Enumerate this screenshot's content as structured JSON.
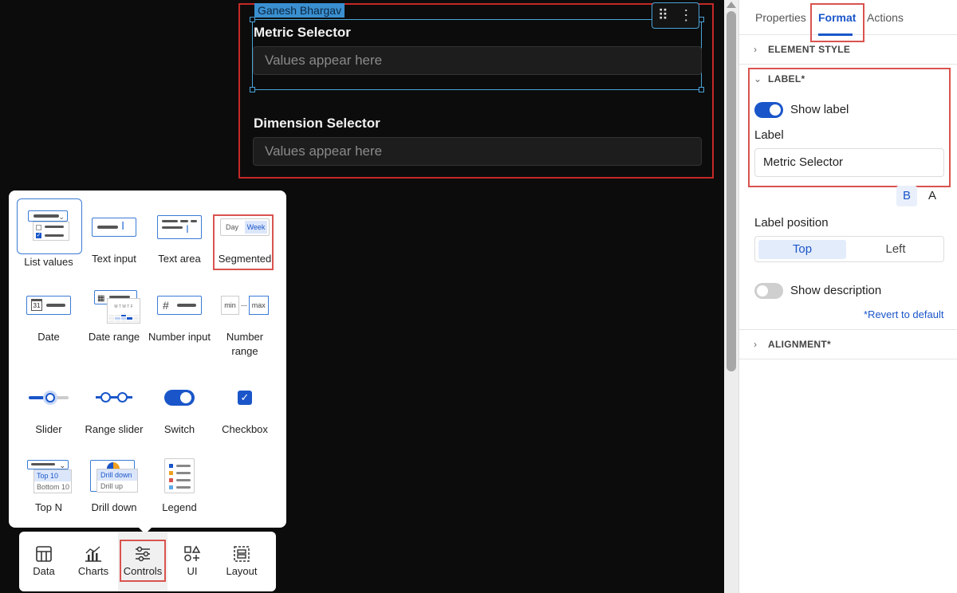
{
  "canvas": {
    "user_tag": "Ganesh Bhargav",
    "fields": [
      {
        "label": "Metric Selector",
        "placeholder": "Values appear here"
      },
      {
        "label": "Dimension Selector",
        "placeholder": "Values appear here"
      }
    ]
  },
  "controls_popup": {
    "items": [
      {
        "label": "List values",
        "icon": "list-values-icon"
      },
      {
        "label": "Text input",
        "icon": "text-input-icon"
      },
      {
        "label": "Text area",
        "icon": "text-area-icon"
      },
      {
        "label": "Segmented",
        "icon": "segmented-icon",
        "seg_day": "Day",
        "seg_week": "Week"
      },
      {
        "label": "Date",
        "icon": "date-icon",
        "cal_num": "31"
      },
      {
        "label": "Date range",
        "icon": "date-range-icon",
        "days": "M T W T F"
      },
      {
        "label": "Number input",
        "icon": "number-input-icon"
      },
      {
        "label": "Number range",
        "icon": "number-range-icon",
        "min": "min",
        "max": "max"
      },
      {
        "label": "Slider",
        "icon": "slider-icon"
      },
      {
        "label": "Range slider",
        "icon": "range-slider-icon"
      },
      {
        "label": "Switch",
        "icon": "switch-icon"
      },
      {
        "label": "Checkbox",
        "icon": "checkbox-icon"
      },
      {
        "label": "Top N",
        "icon": "top-n-icon",
        "top": "Top 10",
        "bottom": "Bottom 10"
      },
      {
        "label": "Drill down",
        "icon": "drill-down-icon",
        "down": "Drill down",
        "up": "Drill up"
      },
      {
        "label": "Legend",
        "icon": "legend-icon"
      }
    ]
  },
  "toolbar": {
    "items": [
      {
        "label": "Data",
        "icon": "table-icon"
      },
      {
        "label": "Charts",
        "icon": "chart-icon"
      },
      {
        "label": "Controls",
        "icon": "sliders-icon"
      },
      {
        "label": "UI",
        "icon": "shapes-icon"
      },
      {
        "label": "Layout",
        "icon": "layout-icon"
      }
    ]
  },
  "panel": {
    "tabs": [
      "Properties",
      "Format",
      "Actions"
    ],
    "active_tab": "Format",
    "sections": {
      "element_style": "ELEMENT STYLE",
      "label": "LABEL*",
      "alignment": "ALIGNMENT*"
    },
    "show_label": "Show label",
    "label_caption": "Label",
    "label_value": "Metric Selector",
    "bold_btn": "B",
    "color_btn": "A",
    "label_position_caption": "Label position",
    "positions": [
      "Top",
      "Left"
    ],
    "show_description": "Show description",
    "revert": "*Revert to default",
    "accent": "#1a56c9"
  }
}
